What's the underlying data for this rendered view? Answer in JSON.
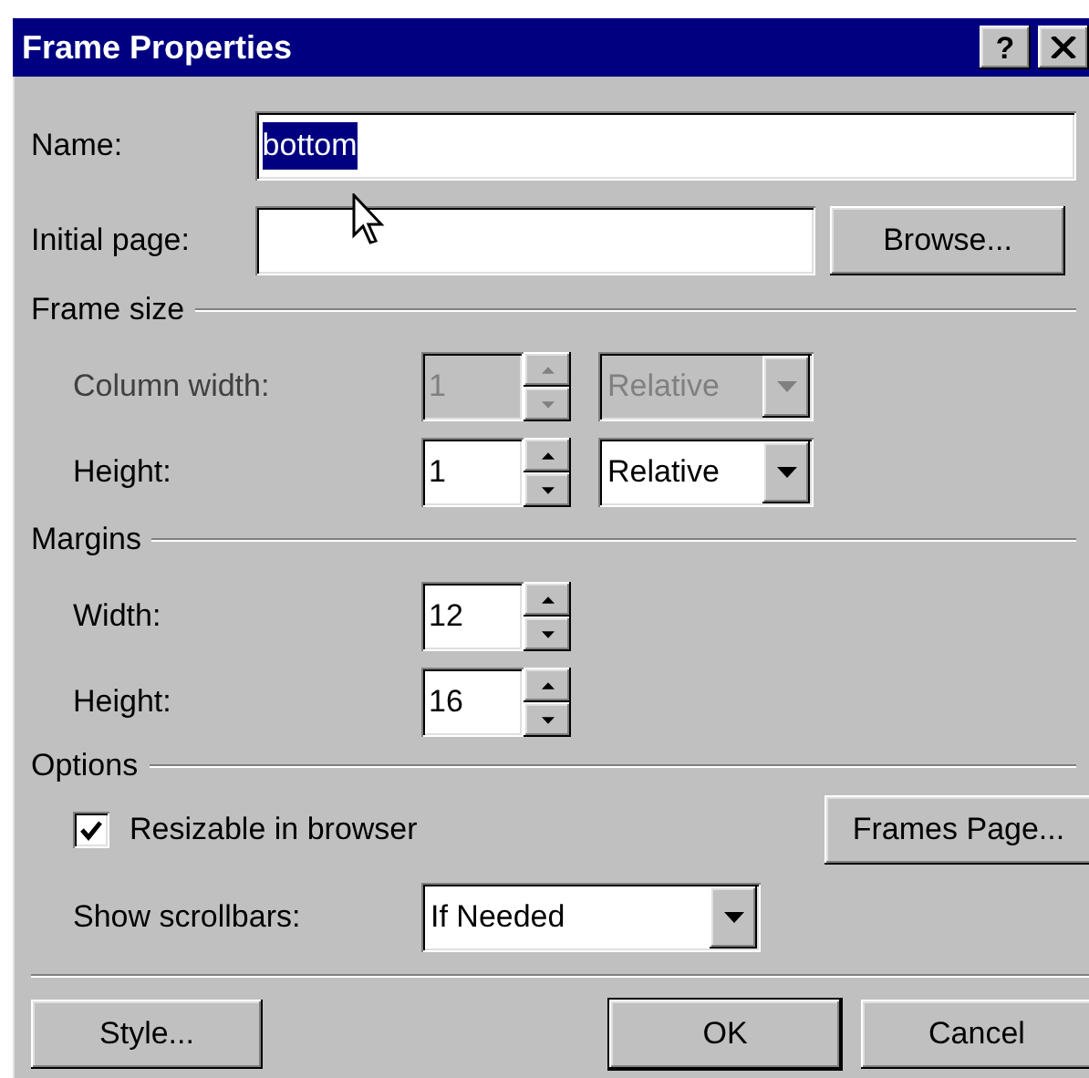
{
  "window": {
    "title": "Frame Properties",
    "help_button": "?"
  },
  "name_field": {
    "label": "Name:",
    "value": "bottom",
    "text_selected": true
  },
  "initial_page": {
    "label": "Initial page:",
    "browse_button": "Browse..."
  },
  "frame_size": {
    "title": "Frame size",
    "rows": [
      {
        "label": "Column width:",
        "value": "1",
        "unit": "Relative",
        "disabled": true
      },
      {
        "label": "Height:",
        "value": "1",
        "unit": "Relative",
        "disabled": false
      }
    ]
  },
  "margins": {
    "title": "Margins",
    "rows": [
      {
        "label": "Width:",
        "value": "12"
      },
      {
        "label": "Height:",
        "value": "16"
      }
    ]
  },
  "options": {
    "title": "Options",
    "resizable": {
      "label": "Resizable in browser",
      "checked": true
    },
    "frames_page_button": "Frames Page...",
    "scrollbars": {
      "label": "Show scrollbars:",
      "value": "If Needed"
    }
  },
  "buttons": [
    {
      "label": "Style...",
      "default": false
    },
    {
      "label": "OK",
      "default": true
    },
    {
      "label": "Cancel",
      "default": false
    }
  ]
}
